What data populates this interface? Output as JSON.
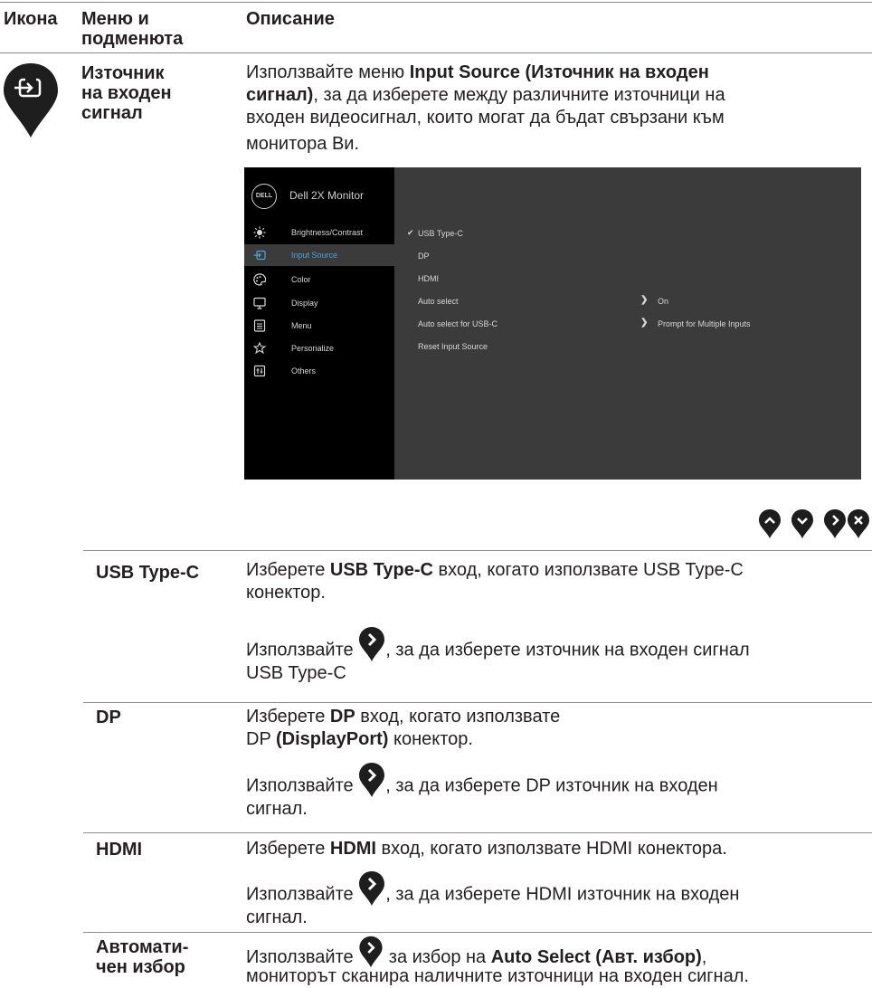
{
  "header": {
    "icon": "Икона",
    "menu_line1": "Меню и",
    "menu_line2": "подменюта",
    "desc": "Описание"
  },
  "main": {
    "title_line1": "Източник",
    "title_line2": "на входен",
    "title_line3": "сигнал",
    "intro_a": "Използвайте меню ",
    "intro_bold1": "Input Source (Източник на входен",
    "intro_bold2": "сигнал)",
    "intro_b": ", за да изберете между различните източници на",
    "intro_c": "входен видеосигнал, които могат да бъдат свързани към",
    "intro_d": "монитора Ви."
  },
  "osd": {
    "logo": "DELL",
    "title": "Dell 2X Monitor",
    "menu": [
      {
        "label": "Brightness/Contrast",
        "icon": "brightness-icon"
      },
      {
        "label": "Input Source",
        "icon": "input-source-icon"
      },
      {
        "label": "Color",
        "icon": "color-palette-icon"
      },
      {
        "label": "Display",
        "icon": "display-icon"
      },
      {
        "label": "Menu",
        "icon": "menu-icon"
      },
      {
        "label": "Personalize",
        "icon": "star-icon"
      },
      {
        "label": "Others",
        "icon": "others-icon"
      }
    ],
    "options": [
      "USB Type-C",
      "DP",
      "HDMI",
      "Auto select",
      "Auto select for USB-C",
      "Reset Input Source"
    ],
    "auto_select_value": "On",
    "auto_usbc_value": "Prompt for Multiple Inputs",
    "selected_option": "USB Type-C"
  },
  "nav_icons": [
    "up-icon",
    "down-icon",
    "right-icon",
    "close-icon"
  ],
  "rows": {
    "usbc": {
      "label": "USB Type-C",
      "l1a": "Изберете ",
      "l1b": "USB Type-C",
      "l1c": " вход, когато използвате USB Type-C",
      "l2": "конектор.",
      "l3a": "Използвайте ",
      "l3b": ", за да изберете източник на входен сигнал",
      "l4": "USB Type-C"
    },
    "dp": {
      "label": "DP",
      "l1a": "Изберете ",
      "l1b": "DP",
      "l1c": " вход, когато използвате",
      "l2a": "DP ",
      "l2b": "(DisplayPort)",
      "l2c": " конектор.",
      "l3a": "Използвайте ",
      "l3b": ", за да изберете DP източник на входен",
      "l4": "сигнал."
    },
    "hdmi": {
      "label": "HDMI",
      "l1a": "Изберете ",
      "l1b": "HDMI",
      "l1c": " вход, когато използвате HDMI конектора.",
      "l3a": "Използвайте ",
      "l3b": ", за да изберете HDMI източник на входен",
      "l4": "сигнал."
    },
    "auto": {
      "label1": "Автомати-",
      "label2": "чен избор",
      "l1a": "Използвайте ",
      "l1b": " за избор на ",
      "l1c": "Auto Select (Авт. избор)",
      "l1d": ",",
      "l2": "мониторът сканира наличните източници на входен сигнал."
    }
  },
  "colors": {
    "osd_bg": "#3b3b3b",
    "osd_sidebar": "#000000",
    "osd_accent": "#4aa3df",
    "pin": "#1e1e1e"
  }
}
